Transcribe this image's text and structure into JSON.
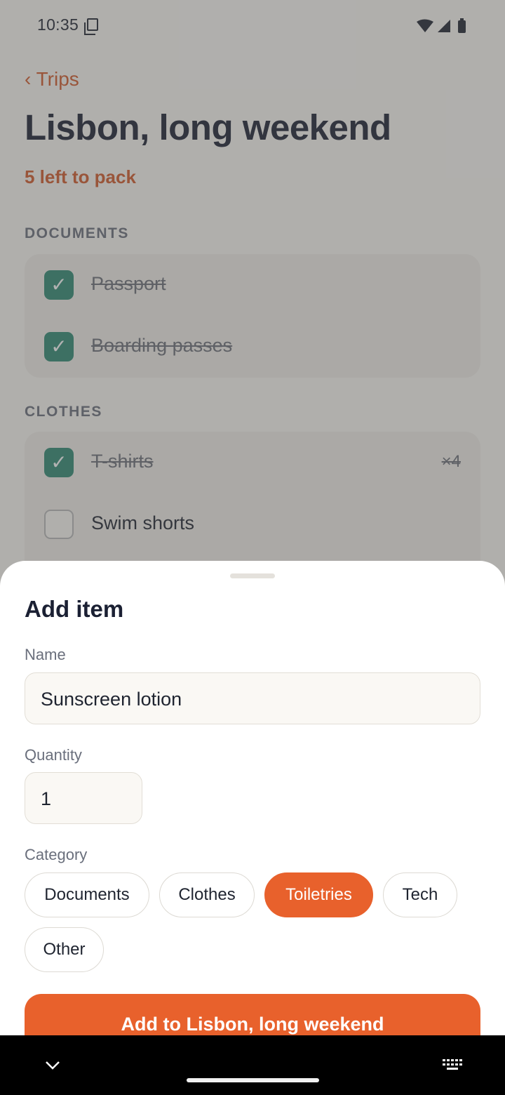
{
  "status_bar": {
    "time": "10:35"
  },
  "header": {
    "back_label": "‹ Trips",
    "title": "Lisbon, long weekend",
    "remaining": "5 left to pack"
  },
  "sections": [
    {
      "heading": "DOCUMENTS",
      "items": [
        {
          "label": "Passport",
          "checked": true
        },
        {
          "label": "Boarding passes",
          "checked": true
        }
      ]
    },
    {
      "heading": "CLOTHES",
      "items": [
        {
          "label": "T-shirts",
          "qty": "×4",
          "checked": true
        },
        {
          "label": "Swim shorts",
          "checked": false
        }
      ]
    }
  ],
  "sheet": {
    "title": "Add item",
    "name_label": "Name",
    "name_value": "Sunscreen lotion",
    "quantity_label": "Quantity",
    "quantity_value": "1",
    "category_label": "Category",
    "categories": [
      "Documents",
      "Clothes",
      "Toiletries",
      "Tech",
      "Other"
    ],
    "selected_category": "Toiletries",
    "submit_label": "Add to Lisbon, long weekend"
  },
  "colors": {
    "accent": "#e8612c",
    "check": "#2f8a73",
    "title": "#1b2033"
  }
}
